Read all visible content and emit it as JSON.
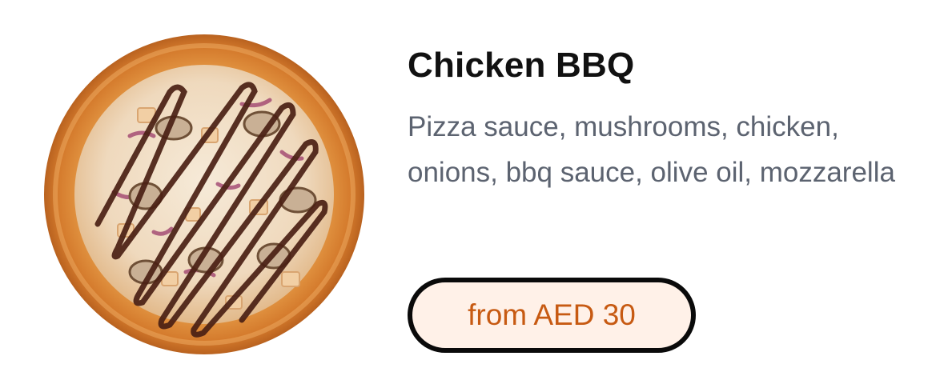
{
  "product": {
    "name": "Chicken BBQ",
    "description": "Pizza sauce, mushrooms, chicken, onions, bbq sauce, olive oil, mozzarella",
    "price_label": "from AED 30",
    "image_icon": "pizza-image"
  },
  "colors": {
    "title": "#111111",
    "description": "#5c6370",
    "price_text": "#c75a12",
    "price_background": "#fff1e8",
    "price_border": "#0a0a0a"
  }
}
